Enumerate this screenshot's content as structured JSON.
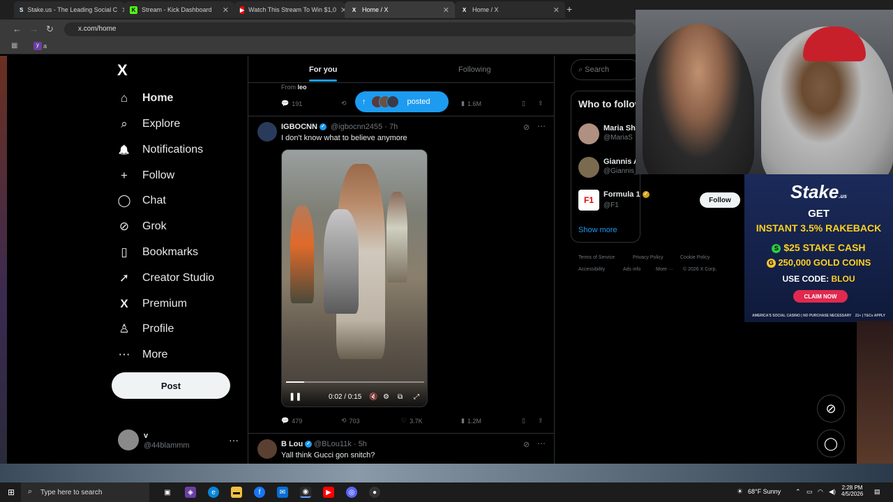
{
  "browser": {
    "tabs": [
      {
        "title": "Stake.us - The Leading Social C",
        "favicon": "S",
        "color": "#1a2c38"
      },
      {
        "title": "Stream - Kick Dashboard",
        "favicon": "K",
        "color": "#53fc18"
      },
      {
        "title": "Watch This Stream To Win $1,0",
        "favicon": "▶",
        "color": "#ff0000"
      },
      {
        "title": "Home / X",
        "favicon": "X",
        "color": "#000000"
      },
      {
        "title": "Home / X",
        "favicon": "X",
        "color": "#000000"
      }
    ],
    "url": "x.com/home",
    "bookmark_label": "a"
  },
  "sidebar": {
    "logo": "X",
    "items": [
      {
        "label": "Home",
        "icon": "⌂"
      },
      {
        "label": "Explore",
        "icon": "⌕"
      },
      {
        "label": "Notifications",
        "icon": "🔔"
      },
      {
        "label": "Follow",
        "icon": "+"
      },
      {
        "label": "Chat",
        "icon": "◯"
      },
      {
        "label": "Grok",
        "icon": "⊘"
      },
      {
        "label": "Bookmarks",
        "icon": "▯"
      },
      {
        "label": "Creator Studio",
        "icon": "➚"
      },
      {
        "label": "Premium",
        "icon": "X"
      },
      {
        "label": "Profile",
        "icon": "♙"
      },
      {
        "label": "More",
        "icon": "⋯"
      }
    ],
    "post_label": "Post",
    "account": {
      "name": "v",
      "handle": "@44blammm",
      "more": "···"
    }
  },
  "feed": {
    "tabs": [
      "For you",
      "Following"
    ],
    "prev_tweet": {
      "from_label": "From",
      "from_name": "leo",
      "replies": "191",
      "views": "1.6M"
    },
    "posted_pill": "posted",
    "tweet1": {
      "name": "IGBOCNN",
      "handle": "@igbocnn2455",
      "time": "· 7h",
      "text": "I don't know what to believe anymore",
      "video_time": "0:02 / 0:15",
      "video_progress": 0.13,
      "replies": "479",
      "reposts": "703",
      "likes": "3.7K",
      "views": "1.2M"
    },
    "tweet2": {
      "name": "B Lou",
      "handle": "@BLou11k",
      "time": "· 5h",
      "text": "Yall think Gucci gon snitch?"
    }
  },
  "right": {
    "search_placeholder": "Search",
    "wtf_title": "Who to follow",
    "suggestions": [
      {
        "name": "Maria Sh",
        "handle": "@MariaS"
      },
      {
        "name": "Giannis A",
        "handle": "@Giannis_An"
      },
      {
        "name": "Formula 1",
        "handle": "@F1"
      }
    ],
    "follow_label": "Follow",
    "show_more": "Show more",
    "footer": [
      "Terms of Service",
      "Privacy Policy",
      "Cookie Policy",
      "Accessibility",
      "Ads info",
      "More ···",
      "© 2026 X Corp."
    ]
  },
  "ad": {
    "brand": "Stake",
    "brand_sub": ".us",
    "line1": "GET",
    "line2": "INSTANT 3.5% RAKEBACK",
    "line3": "$25 STAKE CASH",
    "line4": "250,000 GOLD COINS",
    "code_label": "USE CODE:",
    "code": "BLOU",
    "claim": "CLAIM NOW",
    "fine_left": "AMERICA'S SOCIAL CASINO | NO PURCHASE NECESSARY",
    "fine_right": "21+ | T&Cs APPLY"
  },
  "taskbar": {
    "search_placeholder": "Type here to search",
    "weather": "68°F  Sunny",
    "time": "2:28 PM",
    "date": "4/5/2026"
  },
  "colors": {
    "accent": "#1d9bf0",
    "background": "#000000"
  }
}
